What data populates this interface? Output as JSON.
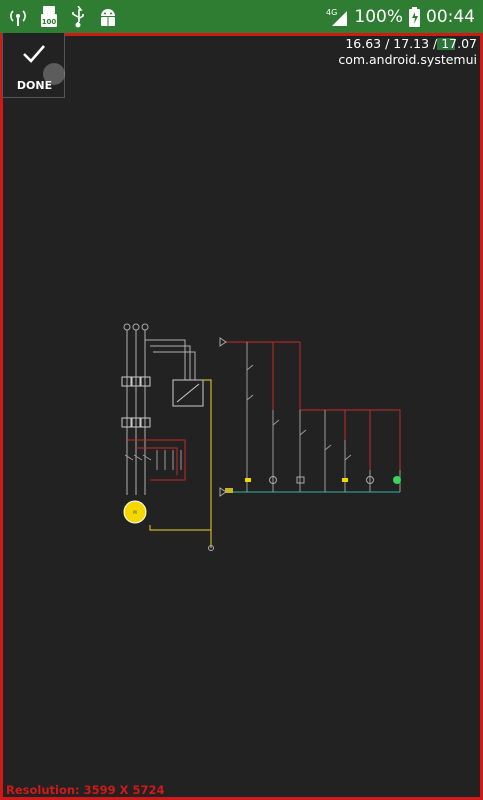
{
  "status_bar": {
    "network_type": "4G",
    "battery_percent": "100%",
    "time": "00:44",
    "icons": [
      "hotspot-icon",
      "storage-100-icon",
      "usb-icon",
      "android-debug-icon",
      "signal-icon",
      "battery-charging-icon"
    ]
  },
  "toolbar": {
    "done_label": "DONE"
  },
  "overlay": {
    "fps_text": "16.63 / 17.13 / 17.07",
    "package_text": "com.android.systemui",
    "resolution_text": "Resolution: 3599 X 5724"
  },
  "colors": {
    "status_bar": "#2e7d32",
    "frame_border": "#d01a1a",
    "background": "#222222",
    "wire_red": "#c62828",
    "wire_yellow": "#c9b32a",
    "wire_teal": "#2fb8a0",
    "motor_yellow": "#f5d800",
    "lamp_green": "#38d65a"
  }
}
